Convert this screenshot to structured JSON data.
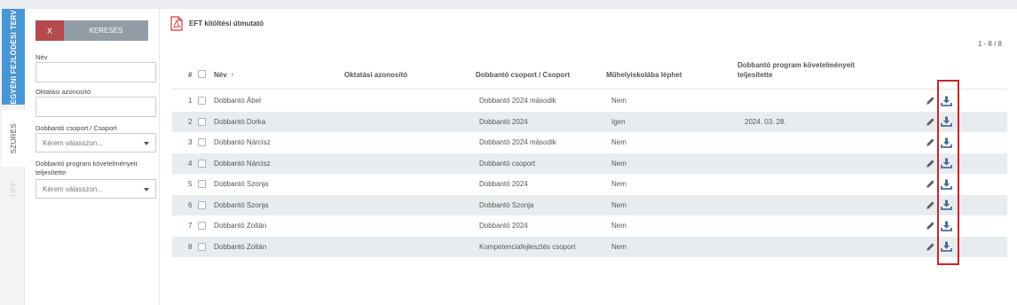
{
  "side_tabs": {
    "career_plan": "EGYÉNI FEJLŐDÉSI TERV",
    "filter": "SZŰRÉS",
    "tip": "TIPP"
  },
  "filter_panel": {
    "clear_label": "X",
    "search_label": "KERESÉS",
    "name_label": "Név",
    "name_value": "",
    "edu_id_label": "Oktatási azonosító",
    "edu_id_value": "",
    "group_label": "Dobbantó csoport / Csoport",
    "group_placeholder": "Kérem válasszon...",
    "req_label": "Dobbantó program követelményeit teljesítette",
    "req_placeholder": "Kérem válasszon..."
  },
  "header": {
    "guide_link": "EFT kitöltési útmutató",
    "pager": "1 - 8 / 8"
  },
  "columns": {
    "num": "#",
    "name": "Név",
    "sort_indicator": "↑",
    "edu_id": "Oktatási azonosító",
    "group": "Dobbantó csoport / Csoport",
    "workshop": "Műhelyiskolába léphet",
    "requirements": "Dobbantó program követelményeit teljesítette"
  },
  "rows": [
    {
      "num": "1",
      "name": "Dobbantó Ábel",
      "edu_id": "",
      "group": "Dobbantó 2024 második",
      "workshop": "Nem",
      "requirements": ""
    },
    {
      "num": "2",
      "name": "Dobbantó Dorka",
      "edu_id": "",
      "group": "Dobbantó 2024",
      "workshop": "Igen",
      "requirements": "2024. 03. 28."
    },
    {
      "num": "3",
      "name": "Dobbantó Nárcisz",
      "edu_id": "",
      "group": "Dobbantó 2024 második",
      "workshop": "Nem",
      "requirements": ""
    },
    {
      "num": "4",
      "name": "Dobbantó Nárcisz",
      "edu_id": "",
      "group": "Dobbantó csoport",
      "workshop": "Nem",
      "requirements": ""
    },
    {
      "num": "5",
      "name": "Dobbantó Szonja",
      "edu_id": "",
      "group": "Dobbantó 2024",
      "workshop": "Nem",
      "requirements": ""
    },
    {
      "num": "6",
      "name": "Dobbantó Szonja",
      "edu_id": "",
      "group": "Dobbantó Szonja",
      "workshop": "Nem",
      "requirements": ""
    },
    {
      "num": "7",
      "name": "Dobbantó Zoltán",
      "edu_id": "",
      "group": "Dobbantó 2024",
      "workshop": "Nem",
      "requirements": ""
    },
    {
      "num": "8",
      "name": "Dobbantó Zoltán",
      "edu_id": "",
      "group": "Kompetenciafejlesztés csoport",
      "workshop": "Nem",
      "requirements": ""
    }
  ],
  "row_actions": [
    "pencil-icon",
    "download-icon"
  ],
  "colors": {
    "active_tab": "#4a96d2",
    "clear_button": "#b44a4d",
    "search_button": "#929ca6",
    "icon_color": "#4a6f94",
    "highlight_box": "#c9252d"
  }
}
